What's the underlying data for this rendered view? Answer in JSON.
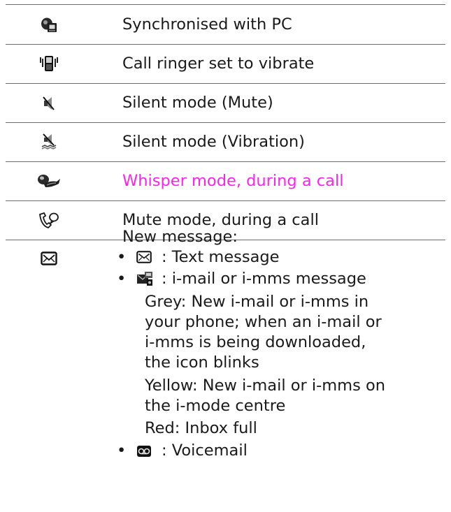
{
  "rows": [
    {
      "icon": "pc-sync-icon",
      "label": "Synchronised with PC"
    },
    {
      "icon": "vibrate-ringer-icon",
      "label": "Call ringer set to vibrate"
    },
    {
      "icon": "silent-mute-icon",
      "label": "Silent mode (Mute)"
    },
    {
      "icon": "silent-vibration-icon",
      "label": "Silent mode (Vibration)"
    },
    {
      "icon": "whisper-mode-icon",
      "label": "Whisper mode, during a call",
      "color": "#ff22ee"
    },
    {
      "icon": "mute-call-icon",
      "label": "Mute mode, during a call"
    }
  ],
  "new_message": {
    "icon": "envelope-icon",
    "title": "New message:",
    "bullet": "•",
    "items": [
      {
        "icon": "envelope-small-icon",
        "text": ": Text message"
      },
      {
        "icon": "imail-icon",
        "text": ": i-mail or i-mms message"
      },
      {
        "icon": "voicemail-icon",
        "text": ": Voicemail"
      }
    ],
    "details": [
      "Grey: New i-mail or i-mms in",
      "your phone; when an i-mail or",
      "i-mms is being downloaded,",
      "the icon blinks",
      "Yellow: New i-mail or i-mms on",
      "the i-mode centre",
      "Red: Inbox full"
    ]
  }
}
